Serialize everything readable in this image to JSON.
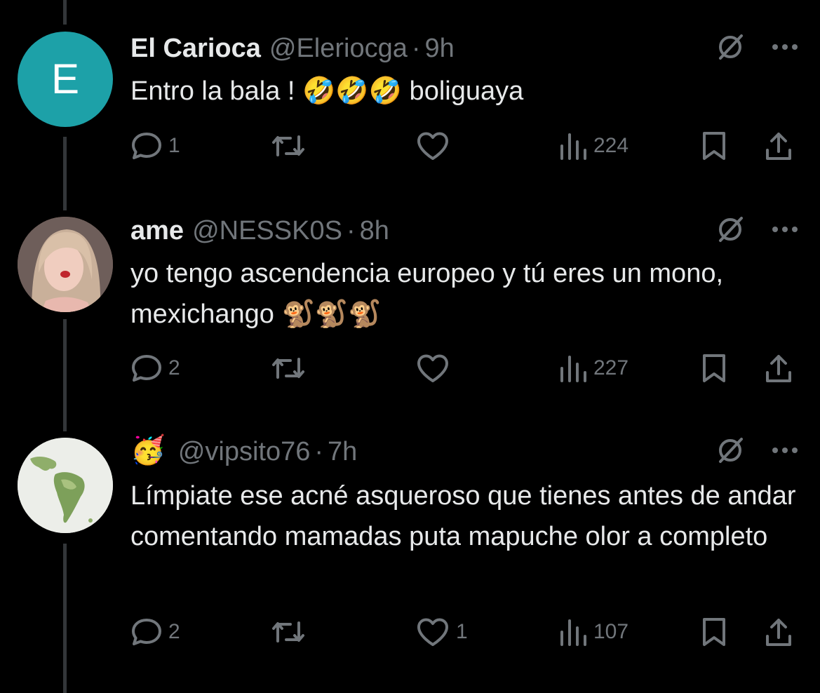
{
  "tweets": [
    {
      "avatar_letter": "E",
      "name": "El Carioca",
      "handle": "@Eleriocga",
      "time": "9h",
      "text_before": "Entro la bala ! ",
      "emoji": "🤣🤣🤣",
      "text_after": " boliguaya",
      "replies": "1",
      "retweets": "",
      "likes": "",
      "views": "224"
    },
    {
      "name": "ame",
      "handle": "@NESSK0S",
      "time": "8h",
      "text_before": "yo tengo ascendencia europeo y tú eres un mono, mexichango ",
      "emoji": "🐒🐒🐒",
      "text_after": "",
      "replies": "2",
      "retweets": "",
      "likes": "",
      "views": "227"
    },
    {
      "name_emoji": "🥳",
      "handle": "@vipsito76",
      "time": "7h",
      "text_before": "Límpiate ese acné asqueroso que tienes antes de andar comentando mamadas puta mapuche olor a completo",
      "emoji": "",
      "text_after": "",
      "replies": "2",
      "retweets": "",
      "likes": "1",
      "views": "107"
    }
  ],
  "separator": "·",
  "colors": {
    "background": "#000000",
    "text": "#e7e9ea",
    "muted": "#71767b",
    "thread_line": "#333639",
    "avatar_teal": "#1da1a8"
  },
  "icons": [
    "reply-icon",
    "retweet-icon",
    "like-icon",
    "views-icon",
    "bookmark-icon",
    "share-icon",
    "grok-icon",
    "more-icon"
  ]
}
